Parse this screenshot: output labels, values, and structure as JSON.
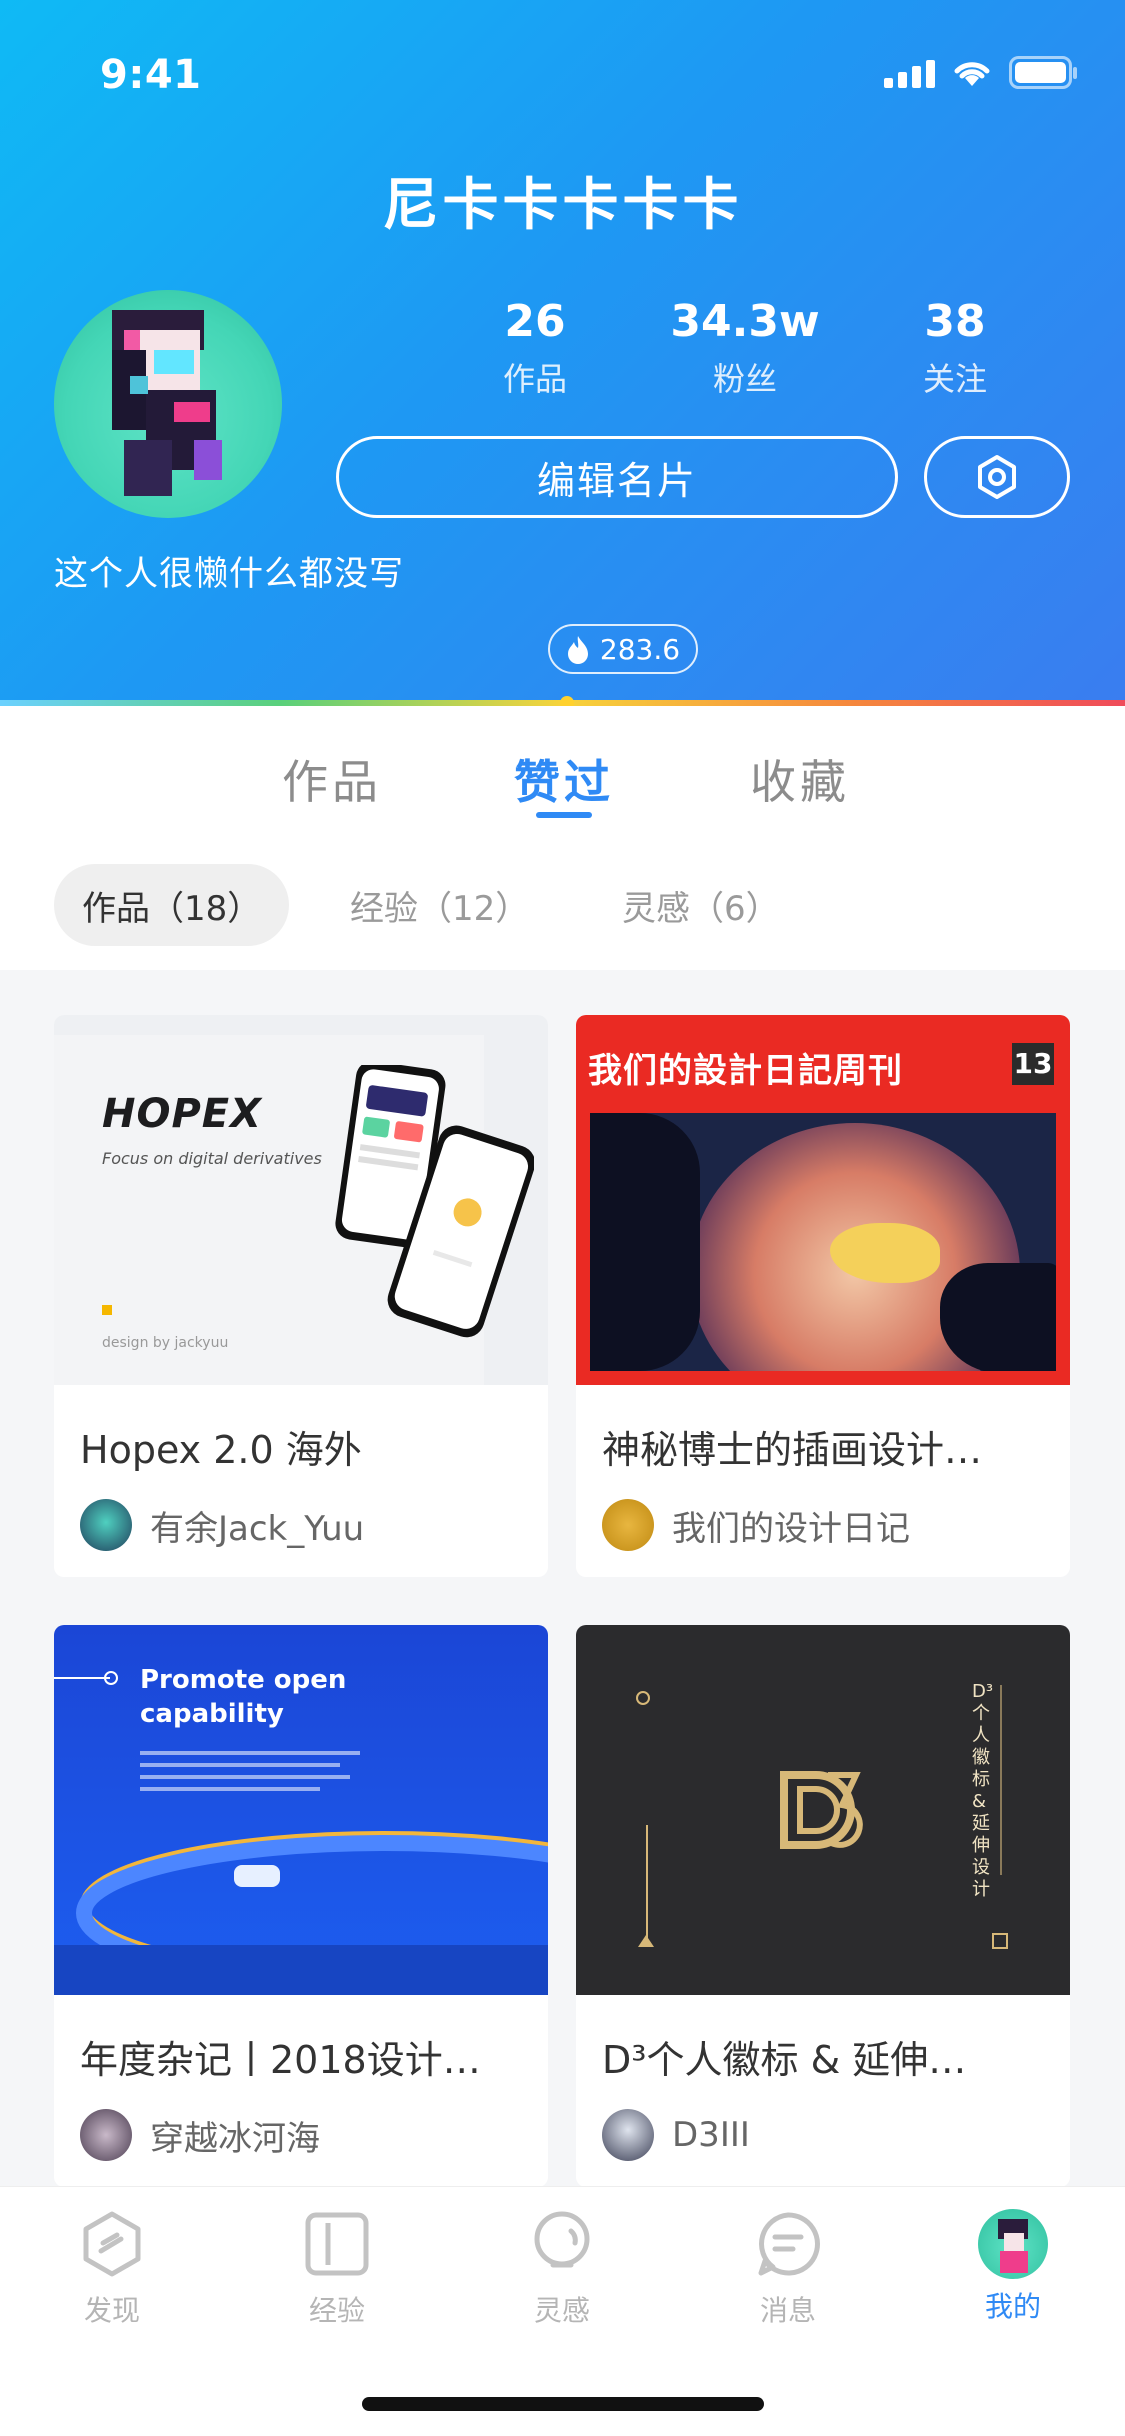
{
  "status_bar": {
    "time": "9:41"
  },
  "profile": {
    "name": "尼卡卡卡卡卡",
    "bio": "这个人很懒什么都没写",
    "heat": "283.6",
    "stats": [
      {
        "value": "26",
        "label": "作品"
      },
      {
        "value": "34.3w",
        "label": "粉丝"
      },
      {
        "value": "38",
        "label": "关注"
      }
    ],
    "edit_label": "编辑名片"
  },
  "tabs": [
    "作品",
    "赞过",
    "收藏"
  ],
  "active_tab": "赞过",
  "filters": [
    "作品（18）",
    "经验（12）",
    "灵感（6）"
  ],
  "cards": [
    {
      "title": "Hopex 2.0 海外",
      "author": "有余Jack_Yuu",
      "image_text": {
        "logo": "HOPEX",
        "tagline": "Focus on digital derivatives",
        "credit": "design by jackyuu"
      }
    },
    {
      "title": "神秘博士的插画设计…",
      "author": "我们的设计日记",
      "image_text": {
        "banner": "我们的設計日記周刊",
        "issue": "13"
      }
    },
    {
      "title": "年度杂记丨2018设计…",
      "author": "穿越冰河海",
      "image_text": {
        "heading": "Promote open capability"
      }
    },
    {
      "title": "D³个人徽标 & 延伸…",
      "author": "D3III",
      "image_text": {
        "vertical": "D³个人徽标 & 延伸设计"
      }
    }
  ],
  "tabbar": [
    {
      "label": "发现",
      "icon": "discover-icon"
    },
    {
      "label": "经验",
      "icon": "experience-icon"
    },
    {
      "label": "灵感",
      "icon": "inspiration-icon"
    },
    {
      "label": "消息",
      "icon": "message-icon"
    },
    {
      "label": "我的",
      "icon": "avatar-icon"
    }
  ],
  "colors": {
    "accent": "#2f8af5",
    "header_start": "#0fbaf5",
    "header_end": "#3a7df0"
  }
}
